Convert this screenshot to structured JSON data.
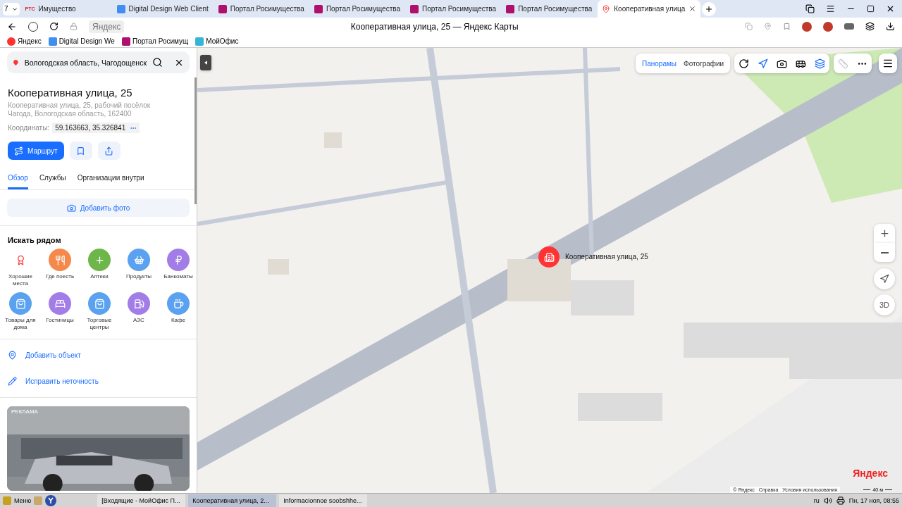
{
  "browser": {
    "tab_counter": "7",
    "tabs": [
      {
        "title": "Имущество",
        "kind": "rts",
        "selected": false
      },
      {
        "title": "Digital Design Web Client",
        "kind": "dd",
        "selected": false
      },
      {
        "title": "Портал Росимущества",
        "kind": "portal",
        "selected": false
      },
      {
        "title": "Портал Росимущества",
        "kind": "portal",
        "selected": false
      },
      {
        "title": "Портал Росимущества",
        "kind": "portal",
        "selected": false
      },
      {
        "title": "Портал Росимущества",
        "kind": "portal",
        "selected": false
      },
      {
        "title": "Кооперативная улица",
        "kind": "maps",
        "selected": true
      }
    ],
    "tab_logo_text": "РТС",
    "site": "Яндекс",
    "page_title": "Кооперативная улица, 25 — Яндекс Карты",
    "bookmarks": [
      {
        "title": "Яндекс",
        "kind": "ya"
      },
      {
        "title": "Digital Design We",
        "kind": "dd"
      },
      {
        "title": "Портал Росимущ",
        "kind": "portal"
      },
      {
        "title": "МойОфис",
        "kind": "office"
      }
    ]
  },
  "sidebar": {
    "search": {
      "value": "Вологодская область, Чагодощенск"
    },
    "place": {
      "title": "Кооперативная улица, 25",
      "address": "Кооперативная улица, 25, рабочий посёлок Чагода, Вологодская область, 162400",
      "coords_label": "Координаты:",
      "coords": "59.163663, 35.326841"
    },
    "route_button": "Маршрут",
    "tabs": [
      {
        "label": "Обзор",
        "selected": true
      },
      {
        "label": "Службы",
        "selected": false
      },
      {
        "label": "Организации внутри",
        "selected": false
      }
    ],
    "add_photo": "Добавить фото",
    "nearby": {
      "title": "Искать рядом",
      "items": [
        {
          "label": "Хорошие места",
          "color": "#ffffff"
        },
        {
          "label": "Где поесть",
          "color": "#f5894b"
        },
        {
          "label": "Аптеки",
          "color": "#6cb64a"
        },
        {
          "label": "Продукты",
          "color": "#5aa2f0"
        },
        {
          "label": "Банкоматы",
          "color": "#a27de8"
        },
        {
          "label": "Товары для дома",
          "color": "#5aa2f0"
        },
        {
          "label": "Гостиницы",
          "color": "#a27de8"
        },
        {
          "label": "Торговые центры",
          "color": "#5aa2f0"
        },
        {
          "label": "АЗС",
          "color": "#a27de8"
        },
        {
          "label": "Кафе",
          "color": "#5aa2f0"
        }
      ]
    },
    "actions": [
      "Добавить объект",
      "Исправить неточность"
    ],
    "ad": {
      "label": "РЕКЛАМА"
    }
  },
  "map": {
    "layer_tabs": [
      {
        "label": "Панорамы",
        "selected": true
      },
      {
        "label": "Фотографии",
        "selected": false
      }
    ],
    "marker_label": "Кооперативная улица, 25",
    "zoom_button": "3D",
    "logo": "Яндекс",
    "footer": [
      "© Яндекс",
      "Справка",
      "Условия использования"
    ],
    "scale": "40 м"
  },
  "taskbar": {
    "menu": "Меню",
    "windows": [
      {
        "title": "[Входящие - МойОфис П...",
        "selected": false
      },
      {
        "title": "Кооперативная улица, 2...",
        "selected": true
      },
      {
        "title": "Informacionnoe soobshhe...",
        "selected": false
      }
    ],
    "lang": "ru",
    "clock": "Пн, 17 ноя, 08:55"
  }
}
